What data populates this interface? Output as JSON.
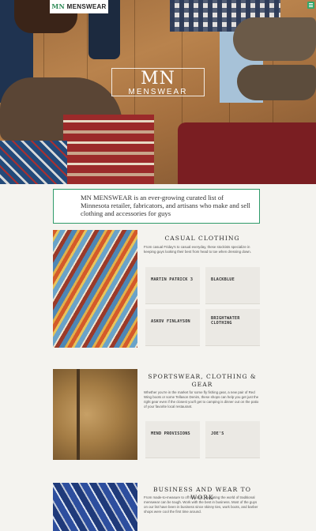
{
  "brand": {
    "mn": "MN",
    "menswear": "MENSWEAR"
  },
  "hero": {
    "logo_mn": "MN",
    "logo_menswear": "MENSWEAR"
  },
  "menu": {
    "icon": "hamburger-menu-icon",
    "color": "#33a86b"
  },
  "intro": {
    "text": "MN MENSWEAR  is an ever-growing curated list of Minnesota retailer, fabricators, and artisans who make and sell clothing and accessories for guys"
  },
  "sections": [
    {
      "title": "CASUAL CLOTHING",
      "description": "From casual Friday's to casual everyday, these stockists specialize in keeping guys looking their best from head to toe when dressing down.",
      "tiles": [
        "MARTIN PATRICK 3",
        "BLACKBLUE",
        "ASKOV FINLAYSON",
        "BRIGHTWATER CLOTHING"
      ]
    },
    {
      "title": "SPORTSWEAR, CLOTHING & GEAR",
      "description": "Whether you're in the market for some fly fishing gear, a new pair of Red Wing boots or some Tellason Denim, these shops can help you get just the right gear even if the closest you'll get to camping is dinner out on the patio of your favorite local restaurant.",
      "tiles": [
        "MEND PROVISIONS",
        "JOE'S"
      ]
    },
    {
      "title": "BUSINESS AND WEAR TO WORK",
      "description": "From made-to-measure to off the rack, navigating the world of traditional menswear can be tough. Work with the best in business. Most of the guys on our list have been in business since skinny ties, work boots, and barber shops were cool the first time around.",
      "tiles": []
    }
  ],
  "colors": {
    "accent": "#2e9b6a",
    "background": "#f4f3ef",
    "tile": "#ebe9e4"
  }
}
